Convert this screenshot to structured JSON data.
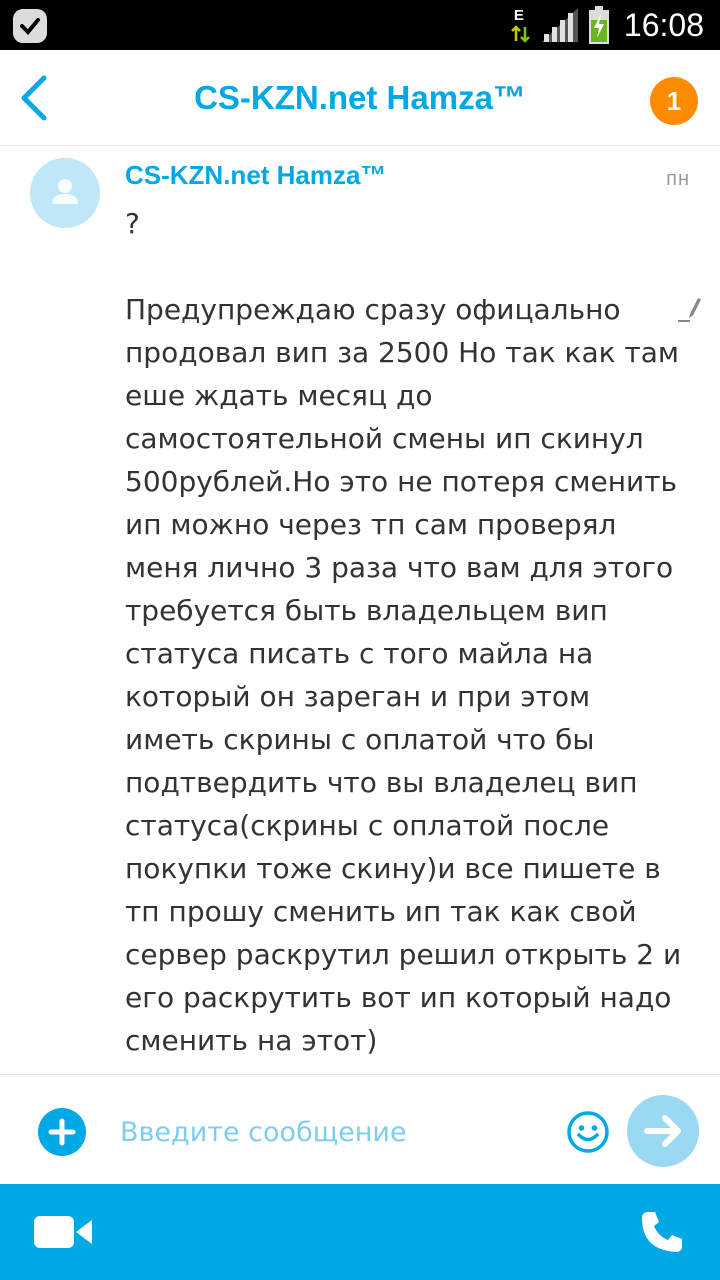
{
  "status_bar": {
    "time": "16:08",
    "network_type": "E",
    "app_icon": "skype-notification-icon",
    "signal_icon": "signal-bars-icon",
    "battery_icon": "battery-charging-icon"
  },
  "header": {
    "title": "CS-KZN.net Hamza™",
    "unread_count": "1",
    "back_icon": "chevron-left-icon"
  },
  "conversation": {
    "messages": [
      {
        "sender": "CS-KZN.net Hamza™",
        "timestamp": "пн",
        "text": "?\n\nПредупреждаю сразу офицально продовал вип за 2500 Но так как там еше ждать месяц до самостоятельной смены ип скинул 500рублей.Но это не потеря сменить ип можно через тп сам проверял меня лично 3 раза что вам для этого требуется быть владельцем вип статуса писать с того майла на который он зареган и при этом иметь скрины с оплатой что бы подтвердить что вы владелец вип статуса(скрины с оплатой после покупки тоже скину)и все пишете в тп прошу сменить ип так как свой сервер раскрутил решил открыть 2 и его раскрутить вот ип который надо сменить на этот)",
        "edited_icon": "pencil-edited-icon"
      }
    ]
  },
  "composer": {
    "placeholder": "Введите сообщение",
    "value": ""
  },
  "colors": {
    "accent": "#00a8e6",
    "badge": "#ff8c00",
    "send_disabled": "#9ad8f3"
  }
}
